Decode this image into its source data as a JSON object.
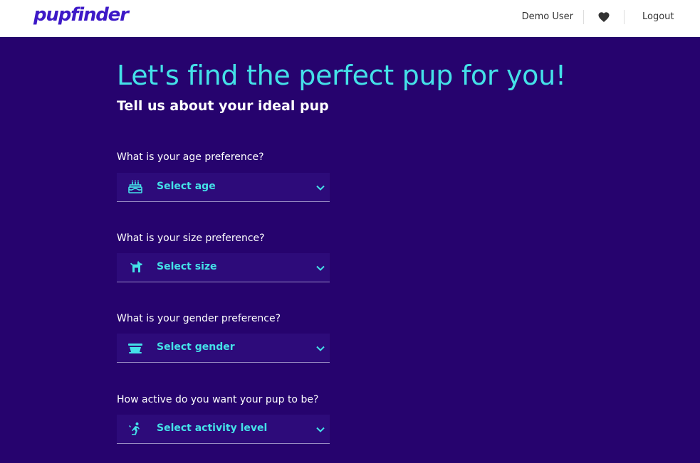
{
  "app": {
    "logo": "pupfinder"
  },
  "nav": {
    "user_name": "Demo User",
    "favorites_icon": "heart-icon",
    "logout_label": "Logout"
  },
  "hero": {
    "title": "Let's find the perfect pup for you!",
    "subtitle": "Tell us about your ideal pup"
  },
  "questions": [
    {
      "label": "What is your age preference?",
      "placeholder": "Select age",
      "icon": "birthday-cake-icon"
    },
    {
      "label": "What is your size preference?",
      "placeholder": "Select size",
      "icon": "dog-icon"
    },
    {
      "label": "What is your gender preference?",
      "placeholder": "Select gender",
      "icon": "dog-bowl-icon"
    },
    {
      "label": "How active do you want your pup to be?",
      "placeholder": "Select activity level",
      "icon": "activity-icon"
    }
  ],
  "colors": {
    "background": "#26036e",
    "accent": "#44e1e8",
    "logo": "#3d19c7",
    "navbar": "#ffffff"
  }
}
